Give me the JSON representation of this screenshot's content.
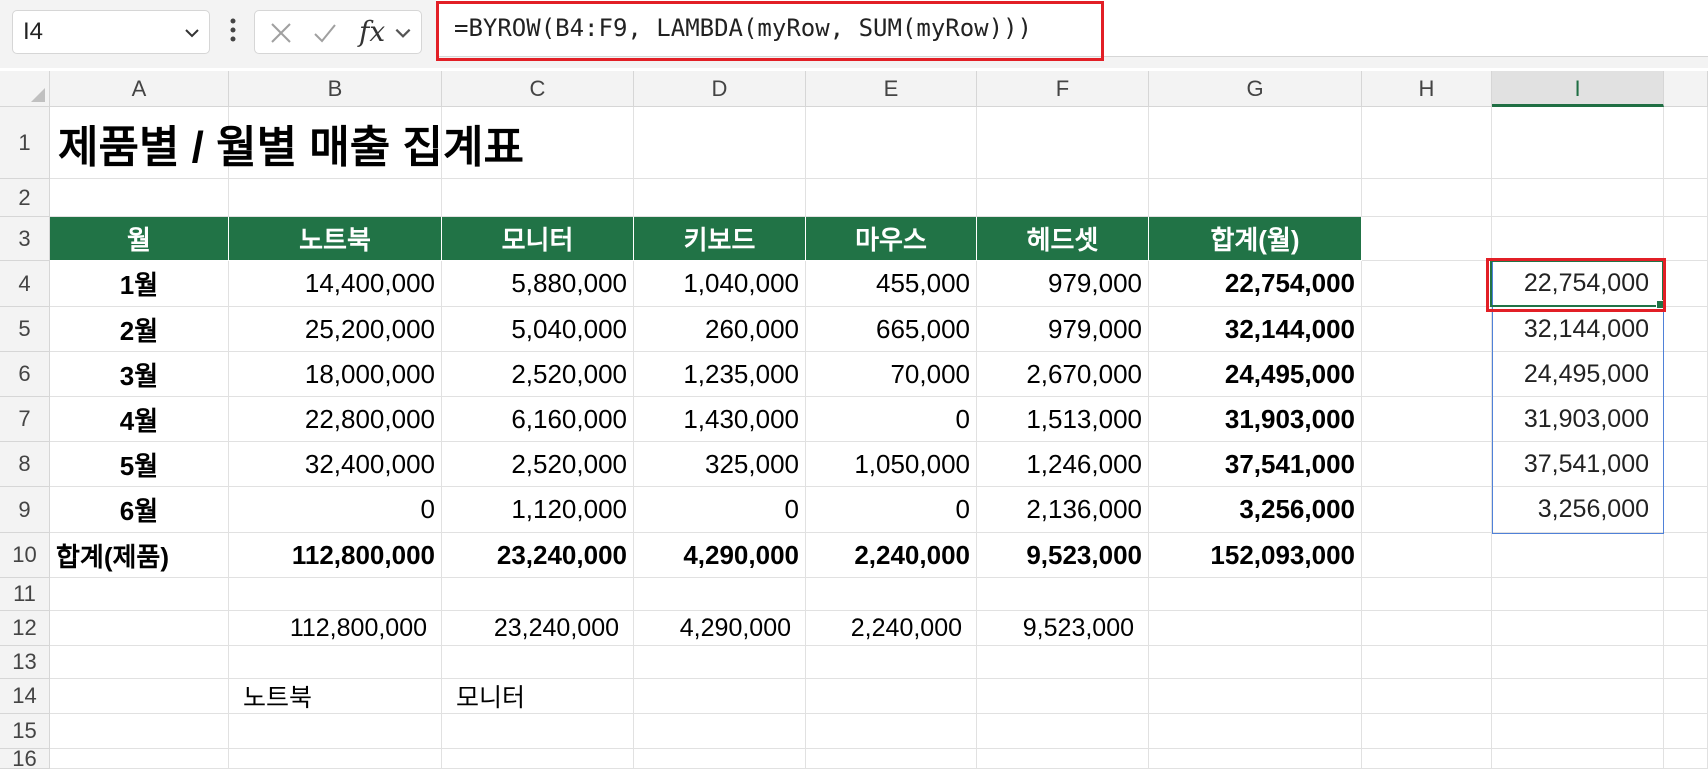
{
  "formula_bar": {
    "name_box": "I4",
    "fx_label": "fx",
    "formula": "=BYROW(B4:F9, LAMBDA(myRow, SUM(myRow)))"
  },
  "columns": [
    "A",
    "B",
    "C",
    "D",
    "E",
    "F",
    "G",
    "H",
    "I"
  ],
  "rows": [
    "1",
    "2",
    "3",
    "4",
    "5",
    "6",
    "7",
    "8",
    "9",
    "10",
    "11",
    "12",
    "13",
    "14",
    "15",
    "16"
  ],
  "sheet": {
    "title": "제품별 / 월별 매출 집계표",
    "headers": [
      "월",
      "노트북",
      "모니터",
      "키보드",
      "마우스",
      "헤드셋",
      "합계(월)"
    ],
    "data": [
      [
        "1월",
        "14,400,000",
        "5,880,000",
        "1,040,000",
        "455,000",
        "979,000",
        "22,754,000"
      ],
      [
        "2월",
        "25,200,000",
        "5,040,000",
        "260,000",
        "665,000",
        "979,000",
        "32,144,000"
      ],
      [
        "3월",
        "18,000,000",
        "2,520,000",
        "1,235,000",
        "70,000",
        "2,670,000",
        "24,495,000"
      ],
      [
        "4월",
        "22,800,000",
        "6,160,000",
        "1,430,000",
        "0",
        "1,513,000",
        "31,903,000"
      ],
      [
        "5월",
        "32,400,000",
        "2,520,000",
        "325,000",
        "1,050,000",
        "1,246,000",
        "37,541,000"
      ],
      [
        "6월",
        "0",
        "1,120,000",
        "0",
        "0",
        "2,136,000",
        "3,256,000"
      ]
    ],
    "totals": [
      "합계(제품)",
      "112,800,000",
      "23,240,000",
      "4,290,000",
      "2,240,000",
      "9,523,000",
      "152,093,000"
    ],
    "row12": [
      "112,800,000",
      "23,240,000",
      "4,290,000",
      "2,240,000",
      "9,523,000"
    ],
    "row14": [
      "노트북",
      "모니터"
    ],
    "spill": [
      "22,754,000",
      "32,144,000",
      "24,495,000",
      "31,903,000",
      "37,541,000",
      "3,256,000"
    ]
  },
  "colors": {
    "header_green": "#217346",
    "highlight_red": "#e21f26",
    "spill_blue": "#4f81d8"
  }
}
